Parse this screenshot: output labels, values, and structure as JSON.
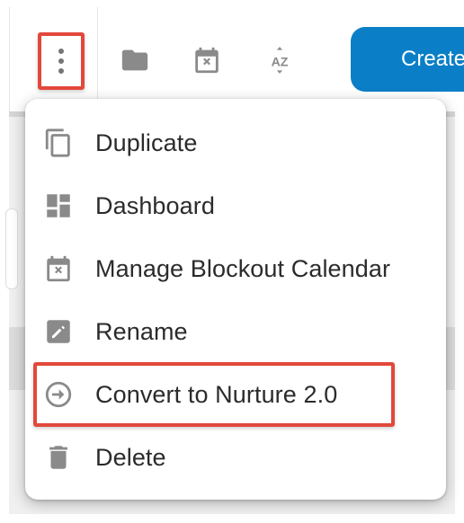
{
  "toolbar": {
    "create_label": "Create",
    "icons": [
      "more-vert-icon",
      "folder-icon",
      "calendar-x-icon",
      "sort-az-icon"
    ]
  },
  "menu": {
    "items": [
      {
        "label": "Duplicate",
        "icon": "copy-icon"
      },
      {
        "label": "Dashboard",
        "icon": "dashboard-icon"
      },
      {
        "label": "Manage Blockout Calendar",
        "icon": "calendar-x-icon"
      },
      {
        "label": "Rename",
        "icon": "pencil-icon"
      },
      {
        "label": "Convert to Nurture 2.0",
        "icon": "arrow-circle-icon"
      },
      {
        "label": "Delete",
        "icon": "trash-icon"
      }
    ]
  },
  "colors": {
    "accent": "#0a7fc7",
    "highlight": "#e2483b",
    "icon": "#757575",
    "text": "#2b2b2b"
  }
}
